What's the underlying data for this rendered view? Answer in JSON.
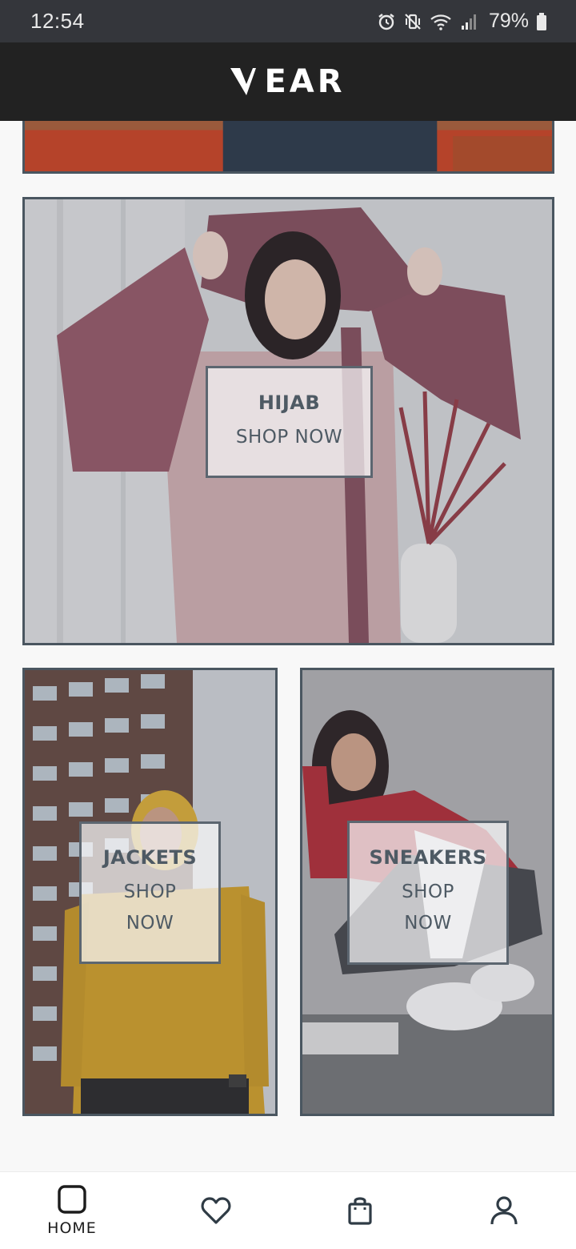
{
  "status_bar": {
    "time": "12:54",
    "battery": "79%",
    "icons": [
      "alarm-icon",
      "vibrate-mute-icon",
      "wifi-icon",
      "signal-icon",
      "battery-icon"
    ]
  },
  "header": {
    "logo_text": "EAR",
    "logo_mark": "V",
    "background": "#222222"
  },
  "tiles": [
    {
      "name": "hijab",
      "title": "HIJAB",
      "cta": "SHOP NOW"
    },
    {
      "name": "jackets",
      "title": "JACKETS",
      "cta": "SHOP NOW"
    },
    {
      "name": "sneakers",
      "title": "SNEAKERS",
      "cta": "SHOP NOW"
    }
  ],
  "bottom_nav": {
    "items": [
      {
        "label": "HOME",
        "icon": "home-icon",
        "active": true
      },
      {
        "label": "",
        "icon": "heart-icon",
        "active": false
      },
      {
        "label": "",
        "icon": "shopping-bag-icon",
        "active": false
      },
      {
        "label": "",
        "icon": "user-icon",
        "active": false
      }
    ]
  },
  "colors": {
    "status_bar": "#34363b",
    "tile_border": "#4a5660",
    "cta_text": "#4e5a64"
  }
}
